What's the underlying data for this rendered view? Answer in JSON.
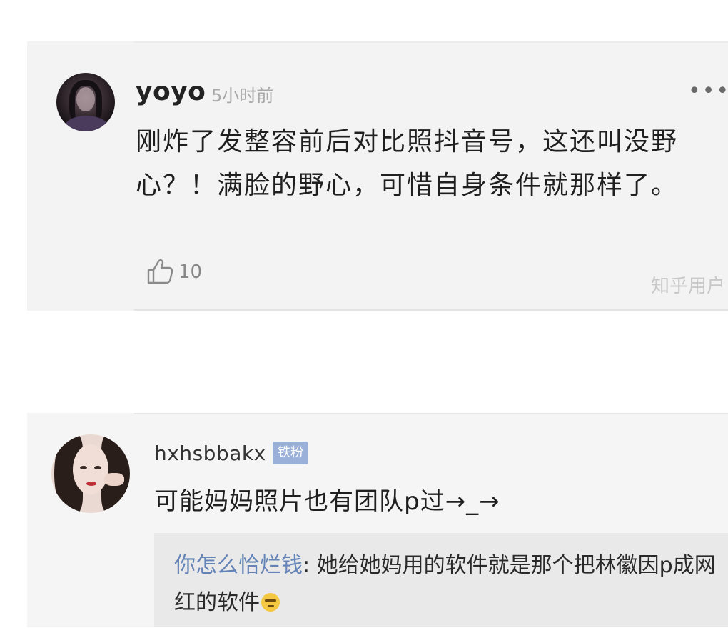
{
  "comments": [
    {
      "username": "yoyo",
      "time": "5小时前",
      "more_label": "•••",
      "content": "刚炸了发整容前后对比照抖音号，这还叫没野心？！满脸的野心，可惜自身条件就那样了。",
      "likes": "10",
      "watermark": "知乎用户"
    },
    {
      "username": "hxhsbbakx",
      "badge": "铁粉",
      "content": "可能妈妈照片也有团队p过→_→",
      "reply": {
        "name": "你怎么恰烂钱",
        "separator": ": ",
        "text": "她给她妈用的软件就是那个把林徽因p成网红的软件"
      }
    }
  ],
  "icons": {
    "thumbs_up": "thumbs-up-icon",
    "more": "more-dots-icon",
    "emoji": "wink-emoji-icon"
  }
}
